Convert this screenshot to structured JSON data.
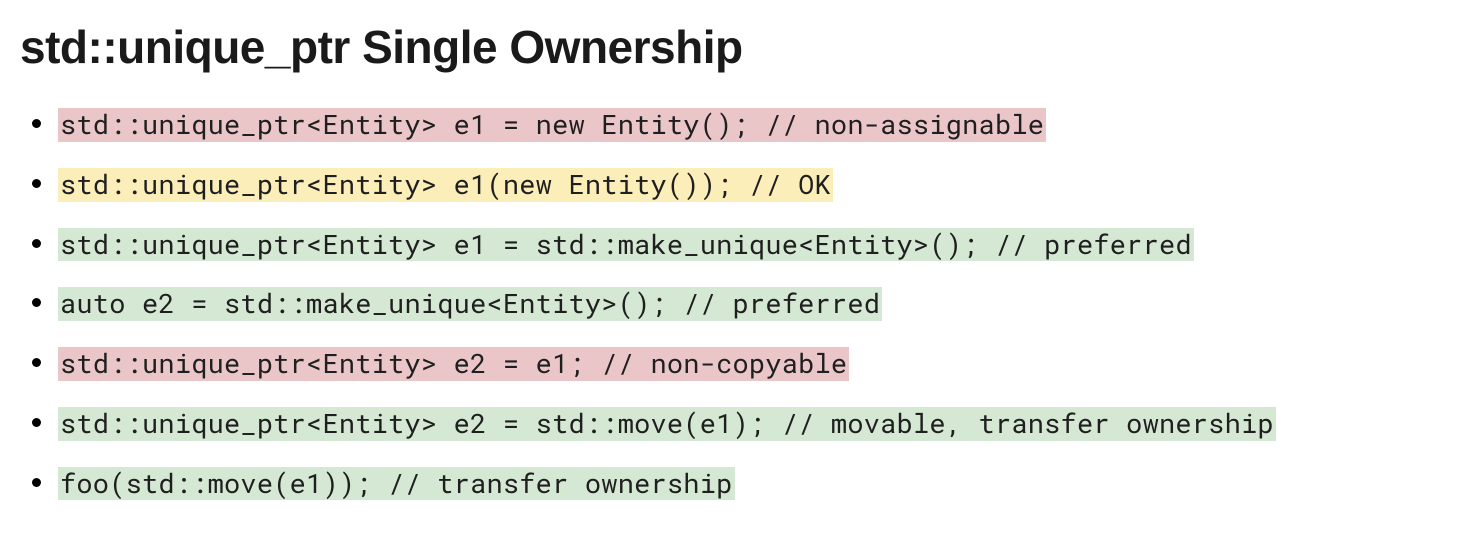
{
  "title": "std::unique_ptr Single Ownership",
  "items": [
    {
      "code": "std::unique_ptr<Entity> e1 = new Entity(); // non-assignable",
      "color": "red"
    },
    {
      "code": "std::unique_ptr<Entity> e1(new Entity()); // OK",
      "color": "yellow"
    },
    {
      "code": "std::unique_ptr<Entity> e1 = std::make_unique<Entity>(); // preferred",
      "color": "green"
    },
    {
      "code": "auto e2 = std::make_unique<Entity>(); // preferred",
      "color": "green"
    },
    {
      "code": "std::unique_ptr<Entity> e2 = e1; // non-copyable",
      "color": "red"
    },
    {
      "code": "std::unique_ptr<Entity> e2 = std::move(e1); // movable, transfer ownership",
      "color": "green"
    },
    {
      "code": "foo(std::move(e1)); // transfer ownership",
      "color": "green"
    }
  ],
  "colors": {
    "red": "#eac6c9",
    "yellow": "#fbeeb8",
    "green": "#d5e8d4"
  }
}
